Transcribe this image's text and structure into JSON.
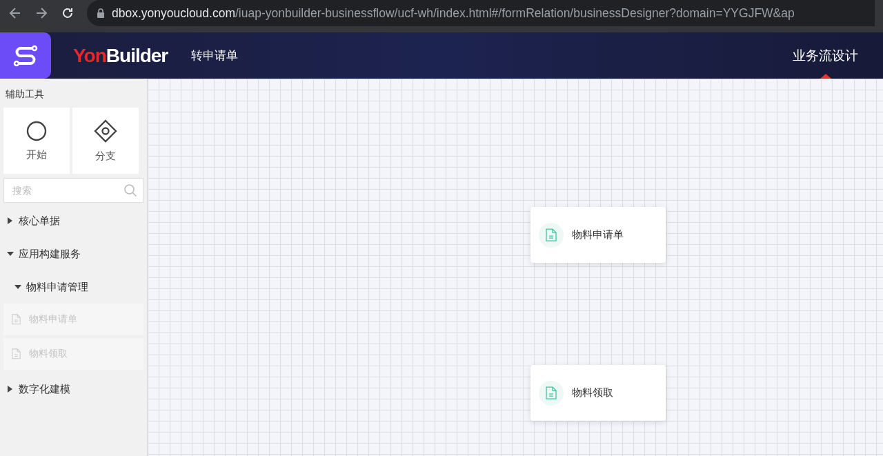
{
  "browser": {
    "domain": "dbox.yonyoucloud.com",
    "path": "/iuap-yonbuilder-businessflow/ucf-wh/index.html#/formRelation/businessDesigner?domain=YYGJFW&ap"
  },
  "header": {
    "logo_text_1": "Yon",
    "logo_text_2": "Builder",
    "page_title": "转申请单",
    "tabs": [
      {
        "label": "业务流设计",
        "selected": true
      }
    ]
  },
  "sidebar": {
    "title": "辅助工具",
    "tools": [
      {
        "kind": "start",
        "label": "开始"
      },
      {
        "kind": "branch",
        "label": "分支"
      }
    ],
    "search": {
      "placeholder": "搜索"
    },
    "tree": [
      {
        "label": "核心单据",
        "expanded": false
      },
      {
        "label": "应用构建服务",
        "expanded": true,
        "children": [
          {
            "label": "物料申请管理",
            "expanded": true,
            "children": [
              {
                "label": "物料申请单",
                "disabled": true
              },
              {
                "label": "物料领取",
                "disabled": true
              }
            ]
          }
        ]
      },
      {
        "label": "数字化建模",
        "expanded": false
      }
    ]
  },
  "canvas": {
    "nodes": [
      {
        "label": "物料申请单"
      },
      {
        "label": "物料领取"
      }
    ]
  }
}
